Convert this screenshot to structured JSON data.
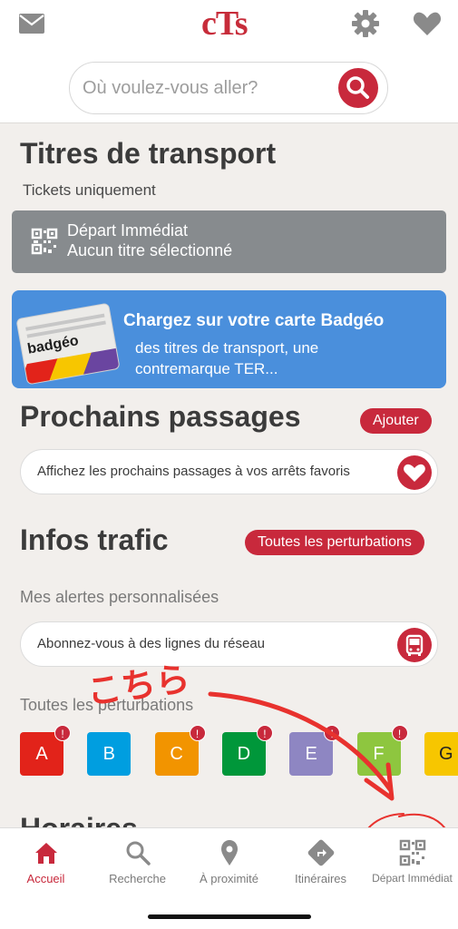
{
  "header": {
    "logo": "cTs",
    "search_placeholder": "Où voulez-vous aller?",
    "icons": [
      "mail-icon",
      "gear-icon",
      "heart-icon",
      "search-icon"
    ]
  },
  "tickets": {
    "title": "Titres de transport",
    "subtitle": "Tickets uniquement",
    "depart_line1": "Départ Immédiat",
    "depart_line2": "Aucun titre sélectionné"
  },
  "badgeo": {
    "card_label": "badgéo",
    "title": "Chargez sur votre carte Badgéo",
    "line1": "des titres de transport, une",
    "line2": "contremarque TER..."
  },
  "prochains": {
    "title": "Prochains passages",
    "add_button": "Ajouter",
    "favorites_text": "Affichez les prochains passages à vos arrêts favoris"
  },
  "infos": {
    "title": "Infos trafic",
    "all_button": "Toutes les perturbations",
    "alerts_label": "Mes alertes personnalisées",
    "subscribe_text": "Abonnez-vous à des lignes du réseau",
    "all_label": "Toutes les perturbations",
    "alert_mark": "!"
  },
  "lines": [
    {
      "label": "A",
      "color": "#e2231a",
      "alert": true
    },
    {
      "label": "B",
      "color": "#009ee0",
      "alert": false
    },
    {
      "label": "C",
      "color": "#f29400",
      "alert": true
    },
    {
      "label": "D",
      "color": "#00973a",
      "alert": true
    },
    {
      "label": "E",
      "color": "#8e86c2",
      "alert": true
    },
    {
      "label": "F",
      "color": "#8ec63f",
      "alert": true
    },
    {
      "label": "G",
      "color": "#f7c600",
      "alert": false
    }
  ],
  "horaires": {
    "title": "Horaires"
  },
  "annotation": {
    "text": "こちら",
    "color": "#e8322e"
  },
  "tabs": [
    {
      "label": "Accueil",
      "icon": "home-icon",
      "active": true
    },
    {
      "label": "Recherche",
      "icon": "search-icon",
      "active": false
    },
    {
      "label": "À proximité",
      "icon": "location-pin-icon",
      "active": false
    },
    {
      "label": "Itinéraires",
      "icon": "directions-icon",
      "active": false
    },
    {
      "label": "Départ Immédiat",
      "icon": "qr-code-icon",
      "active": false
    }
  ],
  "colors": {
    "brand_red": "#c8293c",
    "blue_card": "#4a8fdc",
    "gray_card": "#878b8e"
  }
}
